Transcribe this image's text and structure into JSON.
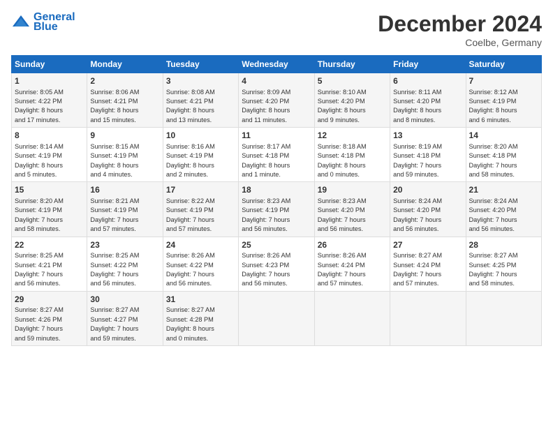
{
  "logo": {
    "line1": "General",
    "line2": "Blue"
  },
  "title": "December 2024",
  "subtitle": "Coelbe, Germany",
  "days_of_week": [
    "Sunday",
    "Monday",
    "Tuesday",
    "Wednesday",
    "Thursday",
    "Friday",
    "Saturday"
  ],
  "weeks": [
    [
      {
        "day": 1,
        "info": "Sunrise: 8:05 AM\nSunset: 4:22 PM\nDaylight: 8 hours\nand 17 minutes."
      },
      {
        "day": 2,
        "info": "Sunrise: 8:06 AM\nSunset: 4:21 PM\nDaylight: 8 hours\nand 15 minutes."
      },
      {
        "day": 3,
        "info": "Sunrise: 8:08 AM\nSunset: 4:21 PM\nDaylight: 8 hours\nand 13 minutes."
      },
      {
        "day": 4,
        "info": "Sunrise: 8:09 AM\nSunset: 4:20 PM\nDaylight: 8 hours\nand 11 minutes."
      },
      {
        "day": 5,
        "info": "Sunrise: 8:10 AM\nSunset: 4:20 PM\nDaylight: 8 hours\nand 9 minutes."
      },
      {
        "day": 6,
        "info": "Sunrise: 8:11 AM\nSunset: 4:20 PM\nDaylight: 8 hours\nand 8 minutes."
      },
      {
        "day": 7,
        "info": "Sunrise: 8:12 AM\nSunset: 4:19 PM\nDaylight: 8 hours\nand 6 minutes."
      }
    ],
    [
      {
        "day": 8,
        "info": "Sunrise: 8:14 AM\nSunset: 4:19 PM\nDaylight: 8 hours\nand 5 minutes."
      },
      {
        "day": 9,
        "info": "Sunrise: 8:15 AM\nSunset: 4:19 PM\nDaylight: 8 hours\nand 4 minutes."
      },
      {
        "day": 10,
        "info": "Sunrise: 8:16 AM\nSunset: 4:19 PM\nDaylight: 8 hours\nand 2 minutes."
      },
      {
        "day": 11,
        "info": "Sunrise: 8:17 AM\nSunset: 4:18 PM\nDaylight: 8 hours\nand 1 minute."
      },
      {
        "day": 12,
        "info": "Sunrise: 8:18 AM\nSunset: 4:18 PM\nDaylight: 8 hours\nand 0 minutes."
      },
      {
        "day": 13,
        "info": "Sunrise: 8:19 AM\nSunset: 4:18 PM\nDaylight: 7 hours\nand 59 minutes."
      },
      {
        "day": 14,
        "info": "Sunrise: 8:20 AM\nSunset: 4:18 PM\nDaylight: 7 hours\nand 58 minutes."
      }
    ],
    [
      {
        "day": 15,
        "info": "Sunrise: 8:20 AM\nSunset: 4:19 PM\nDaylight: 7 hours\nand 58 minutes."
      },
      {
        "day": 16,
        "info": "Sunrise: 8:21 AM\nSunset: 4:19 PM\nDaylight: 7 hours\nand 57 minutes."
      },
      {
        "day": 17,
        "info": "Sunrise: 8:22 AM\nSunset: 4:19 PM\nDaylight: 7 hours\nand 57 minutes."
      },
      {
        "day": 18,
        "info": "Sunrise: 8:23 AM\nSunset: 4:19 PM\nDaylight: 7 hours\nand 56 minutes."
      },
      {
        "day": 19,
        "info": "Sunrise: 8:23 AM\nSunset: 4:20 PM\nDaylight: 7 hours\nand 56 minutes."
      },
      {
        "day": 20,
        "info": "Sunrise: 8:24 AM\nSunset: 4:20 PM\nDaylight: 7 hours\nand 56 minutes."
      },
      {
        "day": 21,
        "info": "Sunrise: 8:24 AM\nSunset: 4:20 PM\nDaylight: 7 hours\nand 56 minutes."
      }
    ],
    [
      {
        "day": 22,
        "info": "Sunrise: 8:25 AM\nSunset: 4:21 PM\nDaylight: 7 hours\nand 56 minutes."
      },
      {
        "day": 23,
        "info": "Sunrise: 8:25 AM\nSunset: 4:22 PM\nDaylight: 7 hours\nand 56 minutes."
      },
      {
        "day": 24,
        "info": "Sunrise: 8:26 AM\nSunset: 4:22 PM\nDaylight: 7 hours\nand 56 minutes."
      },
      {
        "day": 25,
        "info": "Sunrise: 8:26 AM\nSunset: 4:23 PM\nDaylight: 7 hours\nand 56 minutes."
      },
      {
        "day": 26,
        "info": "Sunrise: 8:26 AM\nSunset: 4:24 PM\nDaylight: 7 hours\nand 57 minutes."
      },
      {
        "day": 27,
        "info": "Sunrise: 8:27 AM\nSunset: 4:24 PM\nDaylight: 7 hours\nand 57 minutes."
      },
      {
        "day": 28,
        "info": "Sunrise: 8:27 AM\nSunset: 4:25 PM\nDaylight: 7 hours\nand 58 minutes."
      }
    ],
    [
      {
        "day": 29,
        "info": "Sunrise: 8:27 AM\nSunset: 4:26 PM\nDaylight: 7 hours\nand 59 minutes."
      },
      {
        "day": 30,
        "info": "Sunrise: 8:27 AM\nSunset: 4:27 PM\nDaylight: 7 hours\nand 59 minutes."
      },
      {
        "day": 31,
        "info": "Sunrise: 8:27 AM\nSunset: 4:28 PM\nDaylight: 8 hours\nand 0 minutes."
      },
      null,
      null,
      null,
      null
    ]
  ]
}
